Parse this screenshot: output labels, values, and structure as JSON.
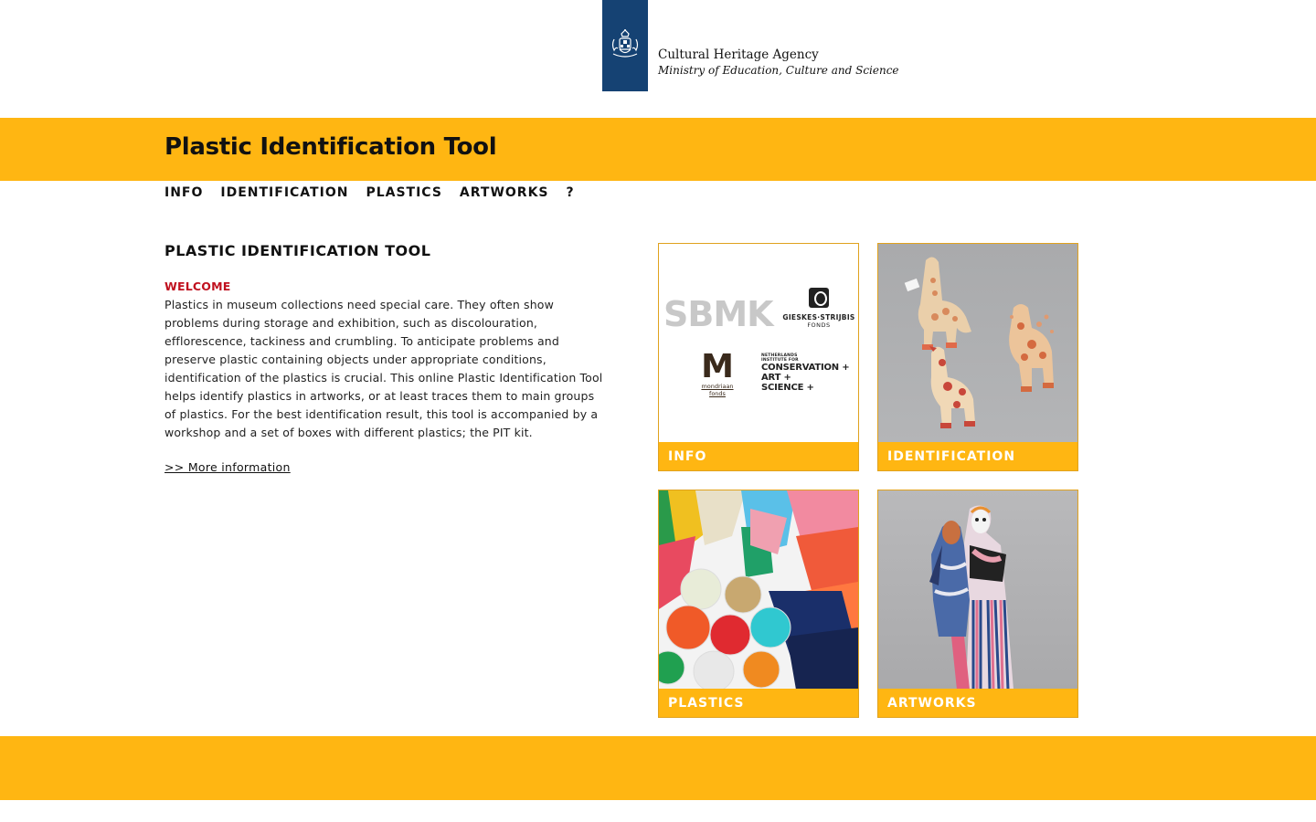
{
  "header": {
    "agency_name": "Cultural Heritage Agency",
    "ministry_name": "Ministry of Education, Culture and Science",
    "logo_icon": "dutch-coat-of-arms-icon",
    "brand_color": "#154273"
  },
  "title_bar": {
    "title": "Plastic Identification Tool",
    "accent_color": "#ffb612"
  },
  "nav": {
    "items": [
      {
        "label": "INFO"
      },
      {
        "label": "IDENTIFICATION"
      },
      {
        "label": "PLASTICS"
      },
      {
        "label": "ARTWORKS"
      },
      {
        "label": "?"
      }
    ]
  },
  "main": {
    "heading": "PLASTIC IDENTIFICATION TOOL",
    "welcome": "WELCOME",
    "body": "Plastics in museum collections need special care. They often show problems during storage and exhibition, such as discolouration, efflorescence, tackiness and crumbling. To anticipate problems and preserve plastic containing objects under appropriate conditions, identification of the plastics is crucial. This online Plastic Identification Tool helps identify plastics in artworks, or at least traces them to main groups of plastics. For the best identification result, this tool is accompanied by a workshop and a set of boxes with different plastics; the PIT kit.",
    "more_link": ">> More information",
    "welcome_color": "#c0111f"
  },
  "tiles": [
    {
      "label": "INFO",
      "image": "sponsor-logos"
    },
    {
      "label": "IDENTIFICATION",
      "image": "degraded-toy-giraffes"
    },
    {
      "label": "PLASTICS",
      "image": "plastic-samples-and-pellets"
    },
    {
      "label": "ARTWORKS",
      "image": "plastic-sculpture-figures"
    }
  ],
  "sponsors": {
    "sbmk": "SBMK",
    "gieskes": "GIESKES·STRIJBIS",
    "gieskes_sub": "FONDS",
    "mondriaan": "M",
    "mondriaan_sub1": "mondriaan",
    "mondriaan_sub2": "fonds",
    "nicas_small1": "NETHERLANDS",
    "nicas_small2": "INSTITUTE FOR",
    "nicas_line1": "CONSERVATION +",
    "nicas_line2": "ART +",
    "nicas_line3": "SCIENCE +"
  }
}
